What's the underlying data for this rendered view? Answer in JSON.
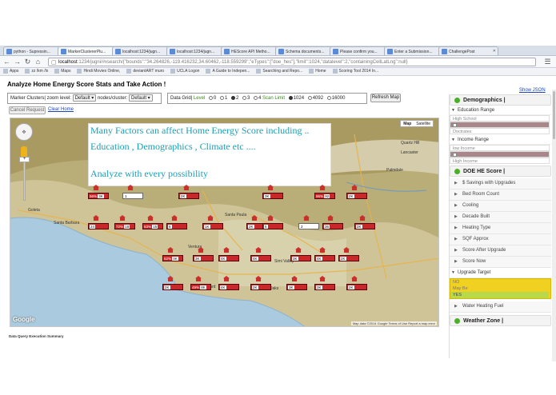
{
  "browser": {
    "tabs": [
      {
        "label": "python - Supressin..."
      },
      {
        "label": "MarkerClustererPlu..."
      },
      {
        "label": "localhost:1234/jugn..."
      },
      {
        "label": "localhost:1234/jugn..."
      },
      {
        "label": "HEScore API Metho..."
      },
      {
        "label": "Schema documents..."
      },
      {
        "label": "Please confirm you..."
      },
      {
        "label": "Enter a Submission..."
      },
      {
        "label": "ChallengePost"
      }
    ],
    "url_host": "localhost",
    "url_rest": ":1234/jugni/#xsearch/{\"bounds\":\"34.264826,-119.416232,34.60462,-118.559299\",\"eTypes\":[\"doe_hes\"],\"limit\":1024,\"datalevel\":2,\"containingCellLatLng\":null}",
    "bookmarks": [
      "Apps",
      "zz /km /lx",
      "Maps",
      "Hindi Movies Online,",
      "deviantART muro",
      "UCLA Logon",
      "A Guide to Indepen...",
      "Searching and Repo...",
      "Home",
      "Scoring Tool 2014 In..."
    ]
  },
  "page": {
    "title": "Analyze Home Energy Score Stats and Take Action !",
    "show_json": "Show JSON",
    "controls": {
      "marker_clusters_label": "Marker Clusters| zoom level:",
      "zoom_value": "Default",
      "nodes_label": "nodes/cluster:",
      "nodes_value": "Default",
      "data_grid_label": "Data Grid|",
      "level_label": "Level",
      "levels": [
        "0",
        "1",
        "2",
        "3",
        "4"
      ],
      "scan_limit_label": "Scan Limit",
      "limits": [
        "1024",
        "4092",
        "16000"
      ],
      "refresh": "Refresh Map",
      "cancel": "Cancel Request",
      "clear_home": "Clear Home"
    },
    "exec_summary": "Data Query Execution Summary"
  },
  "map": {
    "overlay_lines": [
      "Many Factors can affect Home Energy Score including ..",
      "Education , Demographics , Climate etc ....",
      "Analyze with every possibility"
    ],
    "map_type": [
      "Map",
      "Satellite"
    ],
    "google": "Google",
    "footer": "Map data ©2014 Google   Terms of Use   Report a map error",
    "labels": [
      "Lancaster",
      "Palmdale",
      "Quartz Hill",
      "Santa Paula",
      "Ventura",
      "Oxnard",
      "Simi Valley",
      "Thousand Oaks",
      "Santa Barbara",
      "Goleta"
    ],
    "markers": [
      {
        "t": "56%",
        "n": "3K",
        "c": "r"
      },
      {
        "t": "",
        "n": "1",
        "c": "w"
      },
      {
        "t": "",
        "n": "2K",
        "c": "r"
      },
      {
        "t": "",
        "n": "3K",
        "c": "r"
      },
      {
        "t": "96%",
        "n": "92",
        "c": "r"
      },
      {
        "t": "",
        "n": "2K",
        "c": "r"
      },
      {
        "t": "",
        "n": "24",
        "c": "r"
      },
      {
        "t": "72%",
        "n": "18",
        "c": "r"
      },
      {
        "t": "53%",
        "n": "15",
        "c": "r"
      },
      {
        "t": "",
        "n": "8",
        "c": "r"
      },
      {
        "t": "",
        "n": "1K",
        "c": "r"
      },
      {
        "t": "",
        "n": "2K",
        "c": "r"
      },
      {
        "t": "",
        "n": "5",
        "c": "r"
      },
      {
        "t": "",
        "n": "2",
        "c": "w"
      },
      {
        "t": "",
        "n": "36",
        "c": "r"
      },
      {
        "t": "",
        "n": "2K",
        "c": "r"
      },
      {
        "t": "52%",
        "n": "4K",
        "c": "r"
      },
      {
        "t": "",
        "n": "3K",
        "c": "r"
      },
      {
        "t": "",
        "n": "4K",
        "c": "r"
      },
      {
        "t": "",
        "n": "4K",
        "c": "r"
      },
      {
        "t": "",
        "n": "3K",
        "c": "r"
      },
      {
        "t": "",
        "n": "4K",
        "c": "r"
      },
      {
        "t": "",
        "n": "2K",
        "c": "r"
      },
      {
        "t": "",
        "n": "2K",
        "c": "r"
      },
      {
        "t": "49%",
        "n": "8K",
        "c": "r"
      },
      {
        "t": "",
        "n": "4K",
        "c": "r"
      },
      {
        "t": "",
        "n": "2K",
        "c": "r"
      },
      {
        "t": "",
        "n": "3K",
        "c": "r"
      },
      {
        "t": "",
        "n": "3K",
        "c": "r"
      },
      {
        "t": "",
        "n": "2K",
        "c": "r"
      }
    ]
  },
  "sidebar": {
    "demographics": "Demographics |",
    "education": {
      "label": "Education Range",
      "options": [
        "High School",
        "",
        "Doctrates"
      ]
    },
    "income": {
      "label": "Income Range",
      "options": [
        "low Income",
        "",
        "High Income"
      ]
    },
    "doe_score": "DOE HE Score |",
    "items": [
      "$ Savings with Upgrades",
      "Bed Room Count",
      "Cooling",
      "Decade Built",
      "Heating Type",
      "SQF Approx",
      "Score After Upgrade",
      "Score Now"
    ],
    "upgrade_target": {
      "label": "Upgrade Target",
      "options": [
        "NO",
        "May Be",
        "YES"
      ]
    },
    "water_heating": "Water Heating Fuel",
    "weather_zone": "Weather Zone |"
  },
  "colors": {
    "accent": "#4caf2a",
    "marker": "#c8282a",
    "overlay_text": "#1aa0b8"
  }
}
